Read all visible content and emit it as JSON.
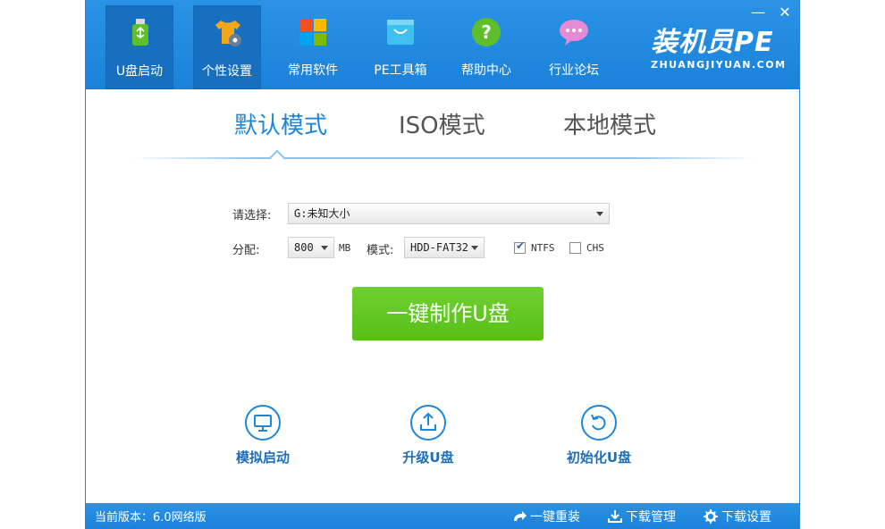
{
  "nav": {
    "items": [
      {
        "label": "U盘启动",
        "icon": "usb-icon",
        "active": true
      },
      {
        "label": "个性设置",
        "icon": "tshirt-gear-icon",
        "active": true
      },
      {
        "label": "常用软件",
        "icon": "windows-grid-icon",
        "active": false
      },
      {
        "label": "PE工具箱",
        "icon": "toolbox-bag-icon",
        "active": false
      },
      {
        "label": "帮助中心",
        "icon": "help-question-icon",
        "active": false
      },
      {
        "label": "行业论坛",
        "icon": "chat-bubble-icon",
        "active": false
      }
    ]
  },
  "window_controls": {
    "minimize": "—",
    "close": "✕"
  },
  "logo": {
    "title": "装机员PE",
    "subtitle": "ZHUANGJIYUAN.COM"
  },
  "modes": {
    "tabs": [
      {
        "label": "默认模式",
        "active": true
      },
      {
        "label": "ISO模式",
        "active": false
      },
      {
        "label": "本地模式",
        "active": false
      }
    ]
  },
  "form": {
    "select_label": "请选择:",
    "drive_value": "G:未知大小",
    "alloc_label": "分配:",
    "alloc_value": "800",
    "alloc_unit": "MB",
    "mode_label": "模式:",
    "mode_value": "HDD-FAT32",
    "ntfs_label": "NTFS",
    "ntfs_checked": true,
    "chs_label": "CHS",
    "chs_checked": false
  },
  "main_button": {
    "label": "一键制作U盘",
    "color": "#5fc41f"
  },
  "tools": [
    {
      "label": "模拟启动",
      "icon": "monitor-icon"
    },
    {
      "label": "升级U盘",
      "icon": "upload-icon"
    },
    {
      "label": "初始化U盘",
      "icon": "reset-arrow-icon"
    }
  ],
  "status": {
    "version": "当前版本：6.0网络版",
    "actions": [
      {
        "label": "一键重装",
        "icon": "redo-arrow-icon"
      },
      {
        "label": "下载管理",
        "icon": "download-icon"
      },
      {
        "label": "下载设置",
        "icon": "gear-icon"
      }
    ]
  },
  "colors": {
    "accent": "#1e86d8",
    "button_green": "#5fc41f"
  }
}
